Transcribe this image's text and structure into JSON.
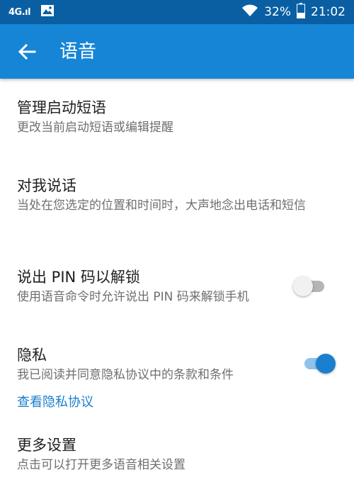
{
  "status_bar": {
    "network": "4G.ıl",
    "battery": "32%",
    "time": "21:02"
  },
  "app_bar": {
    "title": "语音"
  },
  "settings": {
    "manage_phrase": {
      "title": "管理启动短语",
      "summary": "更改当前启动短语或编辑提醒"
    },
    "talk_to_me": {
      "title": "对我说话",
      "summary": "当处在您选定的位置和时间时，大声地念出电话和短信"
    },
    "pin_unlock": {
      "title": "说出 PIN 码以解锁",
      "summary": "使用语音命令时允许说出 PIN 码来解锁手机",
      "enabled": false
    },
    "privacy": {
      "title": "隐私",
      "summary": "我已阅读并同意隐私协议中的条款和条件",
      "enabled": true,
      "link": "查看隐私协议"
    },
    "more": {
      "title": "更多设置",
      "summary": "点击可以打开更多语音相关设置"
    }
  },
  "colors": {
    "status_bar": "#0a5fa3",
    "app_bar": "#1685d6",
    "accent": "#1a7fcf"
  }
}
